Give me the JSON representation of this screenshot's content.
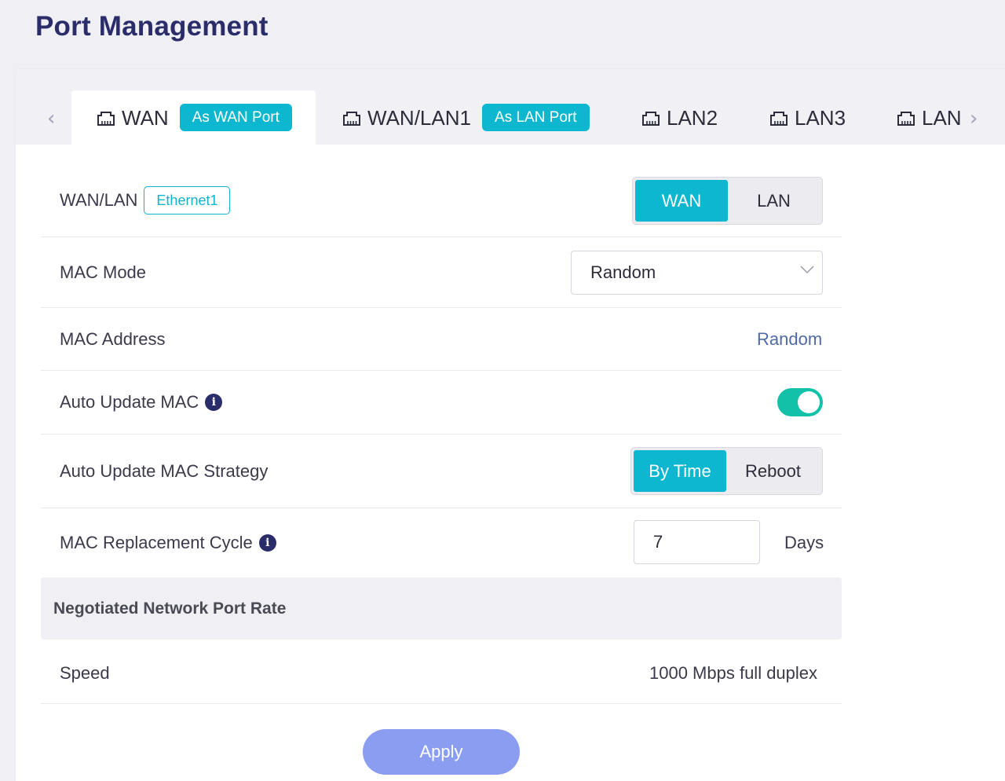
{
  "page": {
    "title": "Port Management"
  },
  "tabs": [
    {
      "label": "WAN",
      "badge": "As WAN Port",
      "active": true
    },
    {
      "label": "WAN/LAN1",
      "badge": "As LAN Port",
      "active": false
    },
    {
      "label": "LAN2",
      "badge": "",
      "active": false
    },
    {
      "label": "LAN3",
      "badge": "",
      "active": false
    },
    {
      "label": "LAN",
      "badge": "",
      "active": false
    }
  ],
  "nav": {
    "prev_icon": "chevron-left-icon",
    "next_icon": "chevron-right-icon",
    "port_icon": "ethernet-port-icon"
  },
  "wan_lan": {
    "label": "WAN/LAN",
    "interface_tag": "Ethernet1",
    "options": [
      "WAN",
      "LAN"
    ],
    "selected": "WAN"
  },
  "mac_mode": {
    "label": "MAC Mode",
    "value": "Random"
  },
  "mac_address": {
    "label": "MAC Address",
    "value": "Random"
  },
  "auto_update_mac": {
    "label": "Auto Update MAC",
    "enabled": true
  },
  "auto_update_strategy": {
    "label": "Auto Update MAC Strategy",
    "options": [
      "By Time",
      "Reboot"
    ],
    "selected": "By Time"
  },
  "mac_replacement_cycle": {
    "label": "MAC Replacement Cycle",
    "value": "7",
    "unit": "Days"
  },
  "negotiated_rate": {
    "section_title": "Negotiated Network Port Rate",
    "speed_label": "Speed",
    "speed_value": "1000 Mbps full duplex"
  },
  "actions": {
    "apply_label": "Apply"
  },
  "colors": {
    "accent": "#0db7cf",
    "toggle_on": "#13c1a9",
    "apply_button": "#8b9df0",
    "title": "#2b2d6b",
    "link": "#4f6aa5"
  }
}
